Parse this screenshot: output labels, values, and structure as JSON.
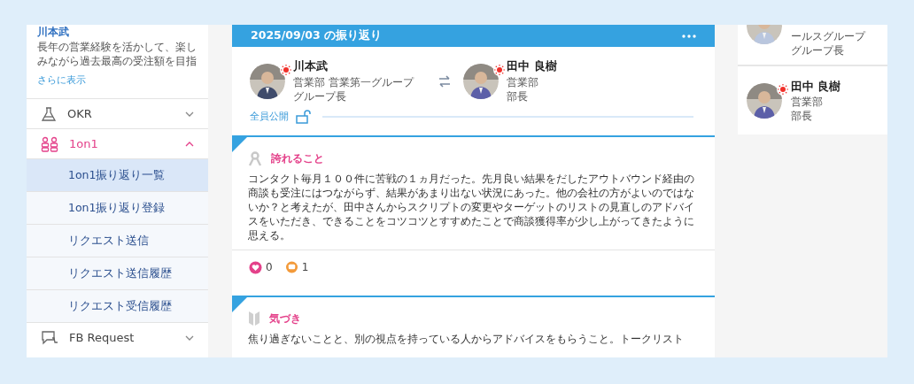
{
  "profile": {
    "name": "川本武",
    "description": "長年の営業経験を活かして、楽しみながら過去最高の受注額を目指",
    "more_link": "さらに表示"
  },
  "nav": [
    {
      "kind": "flask",
      "label": "OKR",
      "expanded": false,
      "active": false
    },
    {
      "kind": "people",
      "label": "1on1",
      "expanded": true,
      "active": true,
      "children": [
        {
          "label": "1on1振り返り一覧",
          "selected": true
        },
        {
          "label": "1on1振り返り登録",
          "selected": false
        },
        {
          "label": "リクエスト送信",
          "selected": false
        },
        {
          "label": "リクエスト送信履歴",
          "selected": false
        },
        {
          "label": "リクエスト受信履歴",
          "selected": false
        }
      ]
    },
    {
      "kind": "feedback",
      "label": "FB Request",
      "expanded": false,
      "active": false
    }
  ],
  "reflection": {
    "title": "2025/09/03 の振り返り",
    "participants": [
      {
        "name": "川本武",
        "department": "営業部 営業第一グループ",
        "role": "グループ長"
      },
      {
        "name": "田中 良樹",
        "department": "営業部",
        "role": "部長"
      }
    ],
    "visibility": "全員公開",
    "sections": [
      {
        "kind": "pride",
        "title": "誇れること",
        "body": "コンタクト毎月１００件に苦戦の１ヵ月だった。先月良い結果をだしたアウトバウンド経由の商談も受注にはつながらず、結果があまり出ない状況にあった。他の会社の方がよいのではないか？と考えたが、田中さんからスクリプトの変更やターゲットのリストの見直しのアドバイスをいただき、できることをコツコツとすすめたことで商談獲得率が少し上がってきたように思える。",
        "likes": "0",
        "comments": "1"
      },
      {
        "kind": "awareness",
        "title": "気づき",
        "body": "焦り過ぎないことと、別の視点を持っている人からアドバイスをもらうこと。トークリスト"
      }
    ]
  },
  "members": [
    {
      "lines": [
        "ールスグループ",
        "グループ長"
      ]
    },
    {
      "name": "田中 良樹",
      "lines": [
        "営業部",
        "部長"
      ]
    }
  ]
}
